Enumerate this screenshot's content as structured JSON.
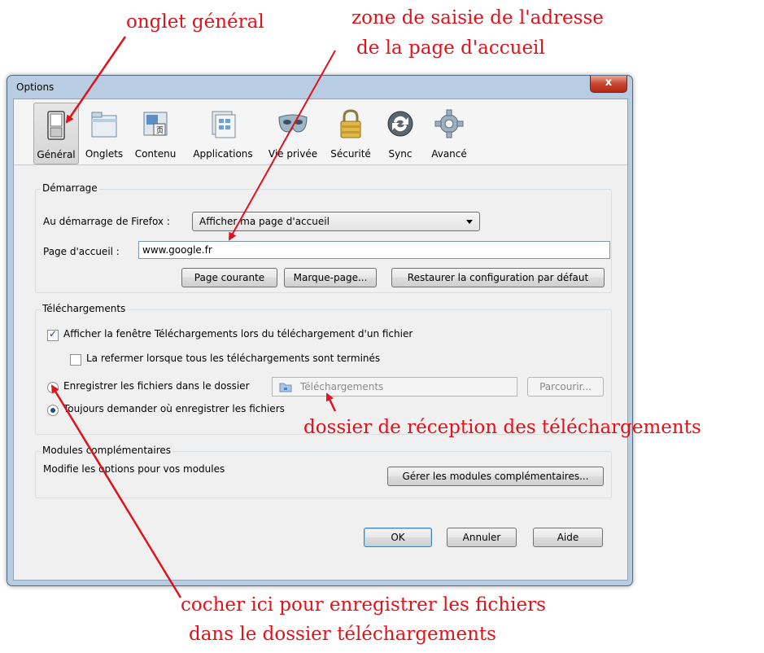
{
  "window": {
    "title": "Options",
    "close_label": "x"
  },
  "toolbar": {
    "items": [
      {
        "label": "Général",
        "icon": "switch-icon",
        "selected": true
      },
      {
        "label": "Onglets",
        "icon": "tabs-icon"
      },
      {
        "label": "Contenu",
        "icon": "content-icon"
      },
      {
        "label": "Applications",
        "icon": "applications-icon"
      },
      {
        "label": "Vie privée",
        "icon": "mask-icon"
      },
      {
        "label": "Sécurité",
        "icon": "lock-icon"
      },
      {
        "label": "Sync",
        "icon": "sync-icon"
      },
      {
        "label": "Avancé",
        "icon": "gear-icon"
      }
    ]
  },
  "startup": {
    "title": "Démarrage",
    "on_start_label": "Au démarrage de Firefox :",
    "on_start_value": "Afficher ma page d'accueil",
    "home_label": "Page d'accueil :",
    "home_value": "www.google.fr",
    "btn_current": "Page courante",
    "btn_bookmark": "Marque-page...",
    "btn_restore": "Restaurer la configuration par défaut"
  },
  "downloads": {
    "title": "Téléchargements",
    "show_window": "Afficher la fenêtre Téléchargements lors du téléchargement d'un fichier",
    "close_when_done": "La refermer lorsque tous les téléchargements sont terminés",
    "save_to_folder": "Enregistrer les fichiers dans le dossier",
    "folder_name": "Téléchargements",
    "browse": "Parcourir...",
    "always_ask": "Toujours demander où enregistrer les fichiers"
  },
  "addons": {
    "title": "Modules complémentaires",
    "desc": "Modifie les options pour vos modules",
    "manage": "Gérer les modules complémentaires..."
  },
  "footer": {
    "ok": "OK",
    "cancel": "Annuler",
    "help": "Aide"
  },
  "annotations": {
    "tab_general": "onglet général",
    "address_zone_1": "zone de saisie de l'adresse",
    "address_zone_2": "de la page d'accueil",
    "download_folder": "dossier de réception  des téléchargements",
    "check_here_1": "cocher ici pour enregistrer  les fichiers",
    "check_here_2": "dans le dossier téléchargements"
  },
  "colors": {
    "annotation": "#e0121b",
    "window_frame": "#b8cde2",
    "close_button": "#c9452e"
  }
}
